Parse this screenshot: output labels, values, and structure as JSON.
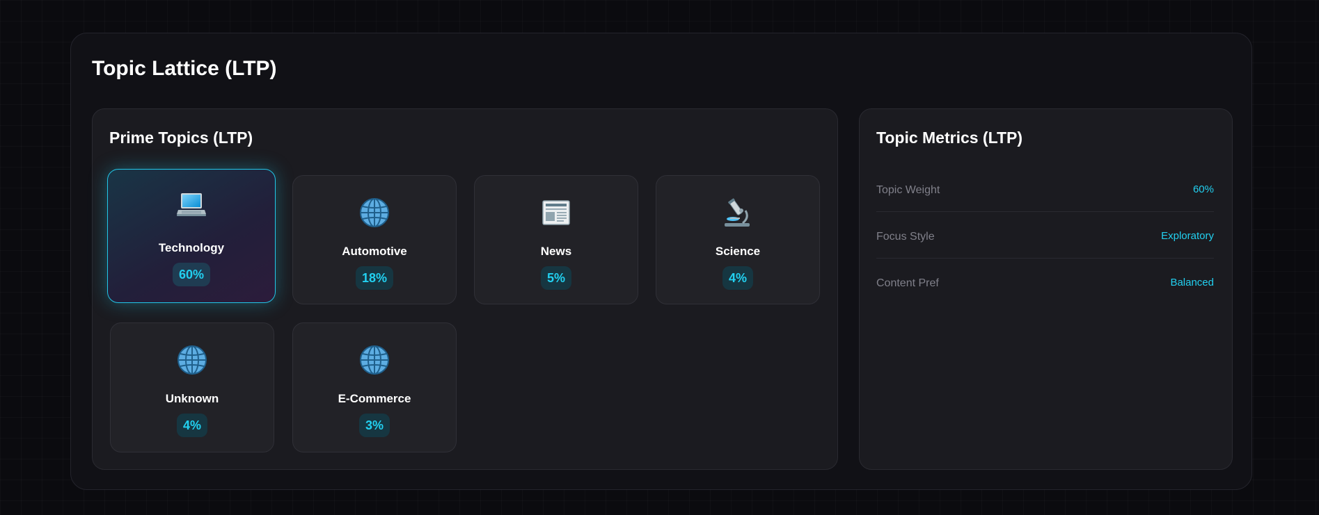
{
  "page": {
    "title": "Topic Lattice (LTP)"
  },
  "prime_topics": {
    "title": "Prime Topics (LTP)",
    "topics": [
      {
        "label": "Technology",
        "percent": "60%",
        "icon": "laptop-icon",
        "active": true
      },
      {
        "label": "Automotive",
        "percent": "18%",
        "icon": "globe-icon",
        "active": false
      },
      {
        "label": "News",
        "percent": "5%",
        "icon": "newspaper-icon",
        "active": false
      },
      {
        "label": "Science",
        "percent": "4%",
        "icon": "microscope-icon",
        "active": false
      },
      {
        "label": "Unknown",
        "percent": "4%",
        "icon": "globe-icon",
        "active": false
      },
      {
        "label": "E-Commerce",
        "percent": "3%",
        "icon": "globe-icon",
        "active": false
      }
    ]
  },
  "metrics": {
    "title": "Topic Metrics (LTP)",
    "rows": [
      {
        "name": "Topic Weight",
        "value": "60%"
      },
      {
        "name": "Focus Style",
        "value": "Exploratory"
      },
      {
        "name": "Content Pref",
        "value": "Balanced"
      }
    ]
  },
  "colors": {
    "accent": "#22d0f0",
    "background": "#0b0b0f",
    "panel": "#111116",
    "card": "#1b1b20",
    "tile": "#222227",
    "muted_text": "#80808a"
  }
}
